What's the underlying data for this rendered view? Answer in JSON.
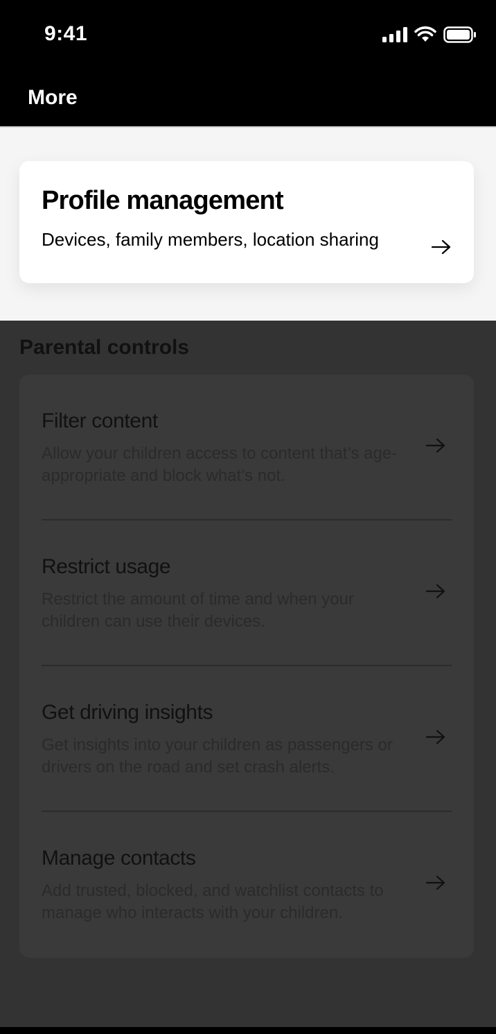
{
  "status": {
    "time": "9:41"
  },
  "header": {
    "title": "More"
  },
  "profile": {
    "title": "Profile management",
    "subtitle": "Devices, family members, location sharing"
  },
  "parental": {
    "section_title": "Parental controls",
    "items": [
      {
        "title": "Filter content",
        "description": "Allow your children access to content that’s age-appropriate and block what’s not."
      },
      {
        "title": "Restrict usage",
        "description": "Restrict the amount of time and when your children can use their devices."
      },
      {
        "title": "Get driving insights",
        "description": "Get insights into your children as passengers or drivers on the road and set crash alerts."
      },
      {
        "title": "Manage contacts",
        "description": "Add trusted, blocked, and watchlist contacts to manage who interacts with your children."
      }
    ]
  },
  "icons": {
    "signal": "cellular-signal-icon",
    "wifi": "wifi-icon",
    "battery": "battery-icon",
    "arrow": "arrow-right-icon"
  },
  "colors": {
    "header_bg": "#000000",
    "page_bg": "#f5f5f5",
    "card_bg": "#ffffff",
    "dim_overlay": "#333333"
  }
}
